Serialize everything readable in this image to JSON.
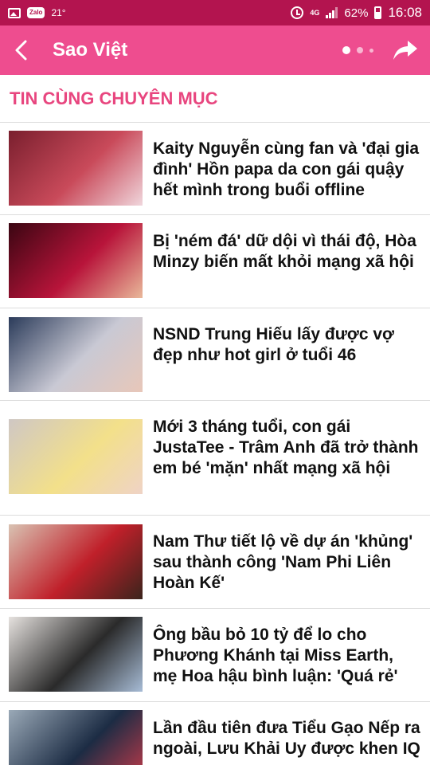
{
  "status_bar": {
    "temperature": "21°",
    "zalo_label": "Zalo",
    "network": "4G",
    "battery": "62%",
    "time": "16:08"
  },
  "app_bar": {
    "title": "Sao Việt",
    "page_indicator": {
      "count": 3,
      "active": 0
    }
  },
  "section": {
    "title": "TIN CÙNG CHUYÊN MỤC"
  },
  "articles": [
    {
      "headline": "Kaity Nguyễn cùng fan và 'đại gia đình' Hồn papa da con gái quậy hết mình trong buổi offline",
      "thumb_colors": [
        "#7a1f2e",
        "#c94a5a",
        "#f0d6dc"
      ]
    },
    {
      "headline": "Bị 'ném đá' dữ dội vì thái độ, Hòa Minzy biến mất khỏi mạng xã hội",
      "thumb_colors": [
        "#3a0612",
        "#b8143a",
        "#e9b89a"
      ]
    },
    {
      "headline": "NSND Trung Hiếu lấy được vợ đẹp như hot girl ở tuổi 46",
      "thumb_colors": [
        "#2b3b5a",
        "#c9c9d4",
        "#e8c7b9"
      ]
    },
    {
      "headline": "Mới 3 tháng tuổi, con gái JustaTee - Trâm Anh đã trở thành em bé 'mặn' nhất mạng xã hội",
      "thumb_colors": [
        "#cfc7c4",
        "#f3e08a",
        "#efd3c6"
      ]
    },
    {
      "headline": "Nam Thư tiết lộ về dự án 'khủng' sau thành công 'Nam Phi Liên Hoàn Kế'",
      "thumb_colors": [
        "#d9c2b2",
        "#c0202a",
        "#3b241c"
      ]
    },
    {
      "headline": "Ông bầu bỏ 10 tỷ để lo cho Phương Khánh tại Miss Earth, mẹ Hoa hậu bình luận: 'Quá rẻ'",
      "thumb_colors": [
        "#e6e2df",
        "#2a2a2a",
        "#a7bcd6"
      ]
    },
    {
      "headline": "Lần đầu tiên đưa Tiểu Gạo Nếp ra ngoài, Lưu Khải Uy được khen IQ ...",
      "thumb_colors": [
        "#9aa9b7",
        "#1c2c44",
        "#c83b4a"
      ]
    }
  ],
  "colors": {
    "status_bar": "#b3144f",
    "app_bar": "#ee4d8f",
    "section_title": "#e8467f",
    "divider": "#dcdcdc"
  },
  "icons": [
    "image-icon",
    "zalo-icon",
    "alarm-icon",
    "signal-icon",
    "battery-icon",
    "back-arrow-icon",
    "share-arrow-icon"
  ]
}
